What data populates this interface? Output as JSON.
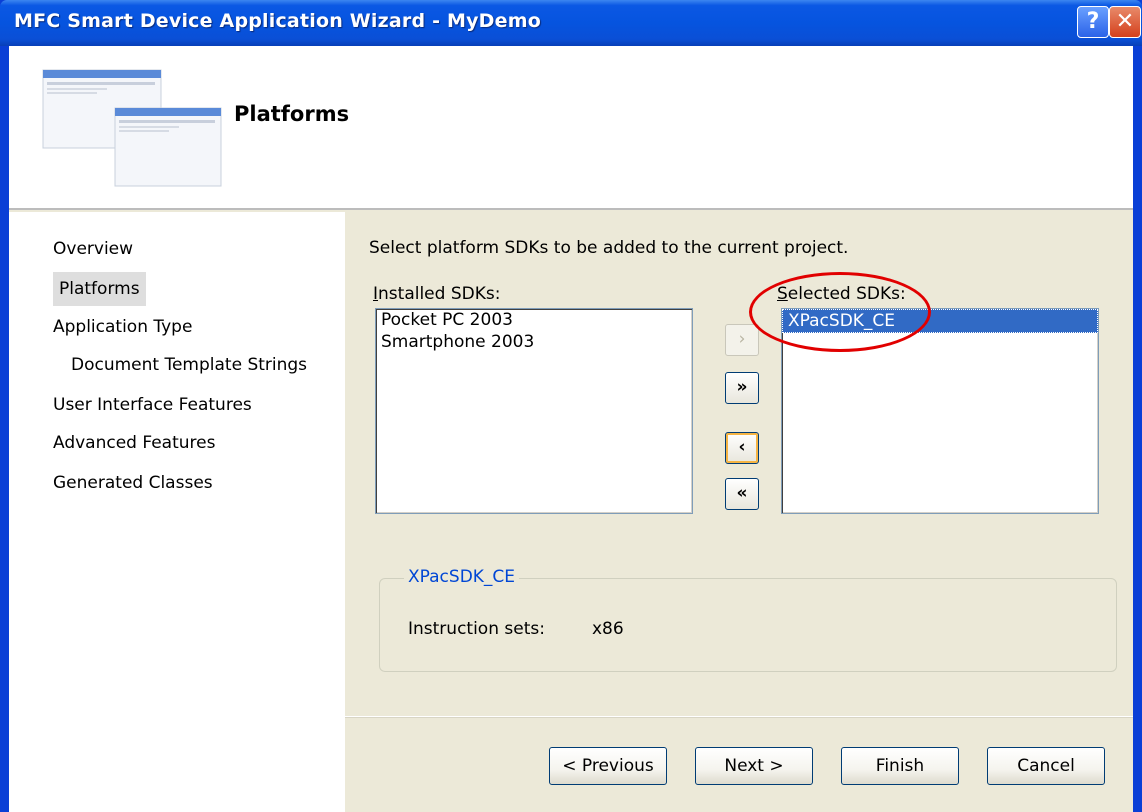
{
  "window": {
    "title": "MFC Smart Device Application Wizard - MyDemo",
    "help_glyph": "?",
    "close_glyph": "✕"
  },
  "header": {
    "title": "Platforms"
  },
  "nav": {
    "items": [
      {
        "label": "Overview"
      },
      {
        "label": "Platforms"
      },
      {
        "label": "Application Type"
      },
      {
        "label": "Document Template Strings"
      },
      {
        "label": "User Interface Features"
      },
      {
        "label": "Advanced Features"
      },
      {
        "label": "Generated Classes"
      }
    ]
  },
  "main": {
    "instruction": "Select platform SDKs to be added to the current project.",
    "installed_label_prefix": "I",
    "installed_label_rest": "nstalled SDKs:",
    "selected_label_prefix": "S",
    "selected_label_rest": "elected SDKs:",
    "installed_sdks": [
      "Pocket PC 2003",
      "Smartphone 2003"
    ],
    "selected_sdks": [
      "XPacSDK_CE"
    ],
    "buttons": {
      "add": "›",
      "add_all": "»",
      "remove": "‹",
      "remove_all": "«"
    },
    "details": {
      "sdk_name": "XPacSDK_CE",
      "instruction_sets_label": "Instruction sets:",
      "instruction_sets_value": "x86"
    }
  },
  "footer": {
    "previous": "< Previous",
    "next": "Next >",
    "finish": "Finish",
    "cancel": "Cancel"
  },
  "colors": {
    "titlebar": "#0654df",
    "selection": "#316ac5",
    "annotation": "#e10000",
    "group_legend": "#0046d5"
  }
}
